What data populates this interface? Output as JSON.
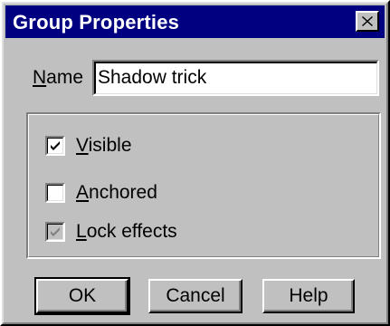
{
  "window": {
    "title": "Group Properties",
    "close_icon": "close-icon"
  },
  "name_field": {
    "label": "Name",
    "value": "Shadow trick"
  },
  "options": [
    {
      "label": "Visible",
      "checked": true,
      "disabled": false
    },
    {
      "label": "Anchored",
      "checked": false,
      "disabled": false
    },
    {
      "label": "Lock effects",
      "checked": true,
      "disabled": true
    }
  ],
  "buttons": {
    "ok": "OK",
    "cancel": "Cancel",
    "help": "Help"
  },
  "colors": {
    "titlebar": "#000080",
    "face": "#c0c0c0",
    "disabled_check": "#808080"
  }
}
